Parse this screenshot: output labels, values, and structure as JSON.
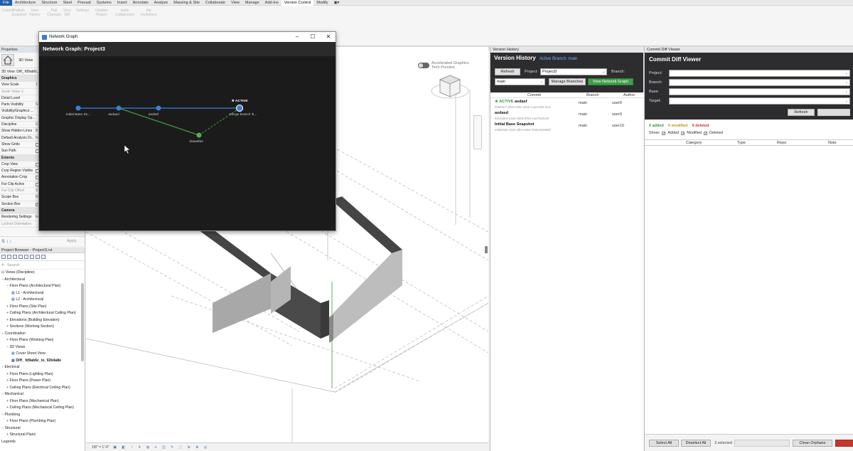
{
  "ribbon": {
    "tabs": [
      "File",
      "Architecture",
      "Structure",
      "Steel",
      "Precast",
      "Systems",
      "Insert",
      "Annotate",
      "Analyze",
      "Massing & Site",
      "Collaborate",
      "View",
      "Manage",
      "Add-Ins",
      "Version Control",
      "Modify"
    ],
    "active_tab": "Version Control",
    "buttons": [
      {
        "label": "Commit",
        "sub": ""
      },
      {
        "label": "Publish",
        "sub": "Snapshot"
      },
      {
        "label": "View",
        "sub": "History"
      },
      {
        "label": "Pull",
        "sub": "Changes"
      },
      {
        "label": "View",
        "sub": "Diff"
      },
      {
        "label": "Settings",
        "sub": ""
      },
      {
        "label": "Initialize",
        "sub": "Project"
      },
      {
        "label": "Invite",
        "sub": "Collaborator"
      },
      {
        "label": "My",
        "sub": "Invitations"
      }
    ]
  },
  "properties": {
    "title": "Properties",
    "type_label": "3D View",
    "view_selector": "3D View: Diff_ fd9ab6c_to",
    "rows": [
      {
        "label": "Graphics",
        "value": "",
        "kind": "section"
      },
      {
        "label": "View Scale",
        "value": "1",
        "kind": "text"
      },
      {
        "label": "Scale Value  1:",
        "value": "",
        "kind": "disabled"
      },
      {
        "label": "Detail Level",
        "value": "",
        "kind": "text"
      },
      {
        "label": "Parts Visibility",
        "value": "S",
        "kind": "text"
      },
      {
        "label": "Visibility/Graphics ...",
        "value": "",
        "kind": "text"
      },
      {
        "label": "Graphic Display Op...",
        "value": "",
        "kind": "text"
      },
      {
        "label": "Discipline",
        "value": "C",
        "kind": "text"
      },
      {
        "label": "Show Hidden Lines",
        "value": "B",
        "kind": "text"
      },
      {
        "label": "Default Analysis Di...",
        "value": "N",
        "kind": "text"
      },
      {
        "label": "Show Grids",
        "value": "",
        "kind": "check"
      },
      {
        "label": "Sun Path",
        "value": "",
        "kind": "check"
      },
      {
        "label": "Extents",
        "value": "",
        "kind": "section"
      },
      {
        "label": "Crop View",
        "value": "",
        "kind": "check"
      },
      {
        "label": "Crop Region Visible",
        "value": "",
        "kind": "check"
      },
      {
        "label": "Annotation Crop",
        "value": "",
        "kind": "check"
      },
      {
        "label": "Far Clip Active",
        "value": "",
        "kind": "check"
      },
      {
        "label": "Far Clip Offset",
        "value": "3",
        "kind": "disabled"
      },
      {
        "label": "Scope Box",
        "value": "N",
        "kind": "text"
      },
      {
        "label": "Section Box",
        "value": "",
        "kind": "checkon"
      },
      {
        "label": "Camera",
        "value": "",
        "kind": "section"
      },
      {
        "label": "Rendering Settings",
        "value": "Edit...",
        "kind": "text"
      },
      {
        "label": "Locked Orientation",
        "value": "",
        "kind": "disabled"
      }
    ],
    "apply_label": "Apply"
  },
  "project_browser": {
    "title": "Project Browser - Project3.rvt",
    "search_placeholder": "Search",
    "items": [
      {
        "label": "Views (Discipline)",
        "level": 0,
        "prefix": "⊟",
        "icon": false,
        "sel": false
      },
      {
        "label": "Architectural",
        "level": 0,
        "prefix": "−",
        "icon": false,
        "sel": false
      },
      {
        "label": "Floor Plans (Architectural Plan)",
        "level": 1,
        "prefix": "−",
        "icon": false,
        "sel": false
      },
      {
        "label": "L1 - Architectural",
        "level": 2,
        "prefix": "",
        "icon": true,
        "sel": false
      },
      {
        "label": "L2 - Architectural",
        "level": 2,
        "prefix": "",
        "icon": true,
        "sel": false
      },
      {
        "label": "Floor Plans (Site Plan)",
        "level": 1,
        "prefix": "+",
        "icon": false,
        "sel": false
      },
      {
        "label": "Ceiling Plans (Architectural Ceiling Plan)",
        "level": 1,
        "prefix": "+",
        "icon": false,
        "sel": false
      },
      {
        "label": "Elevations (Building Elevation)",
        "level": 1,
        "prefix": "+",
        "icon": false,
        "sel": false
      },
      {
        "label": "Sections (Working Section)",
        "level": 1,
        "prefix": "+",
        "icon": false,
        "sel": false
      },
      {
        "label": "Coordination",
        "level": 0,
        "prefix": "−",
        "icon": false,
        "sel": false
      },
      {
        "label": "Floor Plans (Working Plan)",
        "level": 1,
        "prefix": "+",
        "icon": false,
        "sel": false
      },
      {
        "label": "3D Views",
        "level": 1,
        "prefix": "−",
        "icon": false,
        "sel": false
      },
      {
        "label": "Cover Sheet View",
        "level": 2,
        "prefix": "",
        "icon": true,
        "sel": false
      },
      {
        "label": "Diff_ fd9ab6c_to_92b4a8e",
        "level": 2,
        "prefix": "",
        "icon": true,
        "sel": true
      },
      {
        "label": "Electrical",
        "level": 0,
        "prefix": "−",
        "icon": false,
        "sel": false
      },
      {
        "label": "Floor Plans (Lighting Plan)",
        "level": 1,
        "prefix": "+",
        "icon": false,
        "sel": false
      },
      {
        "label": "Floor Plans (Power Plan)",
        "level": 1,
        "prefix": "+",
        "icon": false,
        "sel": false
      },
      {
        "label": "Ceiling Plans (Electrical Ceiling Plan)",
        "level": 1,
        "prefix": "+",
        "icon": false,
        "sel": false
      },
      {
        "label": "Mechanical",
        "level": 0,
        "prefix": "−",
        "icon": false,
        "sel": false
      },
      {
        "label": "Floor Plans (Mechanical Plan)",
        "level": 1,
        "prefix": "+",
        "icon": false,
        "sel": false
      },
      {
        "label": "Ceiling Plans (Mechanical Ceiling Plan)",
        "level": 1,
        "prefix": "+",
        "icon": false,
        "sel": false
      },
      {
        "label": "Plumbing",
        "level": 0,
        "prefix": "−",
        "icon": false,
        "sel": false
      },
      {
        "label": "Floor Plans (Plumbing Plan)",
        "level": 1,
        "prefix": "+",
        "icon": false,
        "sel": false
      },
      {
        "label": "Structural",
        "level": 0,
        "prefix": "−",
        "icon": false,
        "sel": false
      },
      {
        "label": "Structural Plans",
        "level": 1,
        "prefix": "+",
        "icon": false,
        "sel": false
      },
      {
        "label": "Legends",
        "level": 0,
        "prefix": "",
        "icon": false,
        "sel": false
      }
    ]
  },
  "viewport": {
    "accel_line1": "Accelerated Graphics",
    "accel_line2": "Tech Preview",
    "scale": "1/8\" = 1'-0\""
  },
  "network_graph": {
    "window_title": "Network Graph",
    "header": "Network Graph: Project3",
    "active_badge": "★ ACTIVE",
    "nodes": [
      {
        "label": "Initial Base Sn..."
      },
      {
        "label": "asdasd"
      },
      {
        "label": "asdasf"
      },
      {
        "label": "Merge branch 'b..."
      },
      {
        "label": "dsaasfas"
      }
    ],
    "colors": {
      "main": "#3b7fd4",
      "branch": "#3e9a3e",
      "bg": "#1b1b1b"
    }
  },
  "version_history": {
    "pane_title": "Version History",
    "title": "Version History",
    "active_branch": "Active Branch: main",
    "refresh": "Refresh",
    "project_label": "Project:",
    "project_value": "Project3",
    "branch_label": "Branch:",
    "branch_value": "main",
    "manage_branches": "Manage Branches",
    "view_network_graph": "View Network Graph",
    "columns": [
      "Commit",
      "Branch",
      "Author"
    ],
    "commits": [
      {
        "active": "★ ACTIVE",
        "message": "asdasf",
        "hash": "fd9ab6c7-0b44-409c-a932-1ca21369 18ce",
        "branch": "main",
        "author": "user9"
      },
      {
        "active": "",
        "message": "asdasd",
        "hash": "92b4a8e4-e2a0-43b8-87b9-14a7f2cba29",
        "branch": "main",
        "author": "user9"
      },
      {
        "active": "",
        "message": "Initial Base Snapshot",
        "hash": "e0b8d4de-cbd4-4db4-9de0-7b8e2548906f",
        "branch": "main",
        "author": "user10"
      }
    ]
  },
  "commit_diff": {
    "pane_title": "Commit Diff Viewer",
    "title": "Commit Diff Viewer",
    "fields": [
      "Project:",
      "Branch:",
      "Base:",
      "Target:"
    ],
    "refresh": "Refresh",
    "added": "0 added",
    "modified": "0 modified",
    "deleted": "0 deleted",
    "show_label": "Show:",
    "show_added": "Added",
    "show_modified": "Modified",
    "show_deleted": "Deleted",
    "columns": [
      "Category",
      "Type",
      "Repo",
      "Note"
    ],
    "select_all": "Select All",
    "deselect_all": "Deselect All",
    "selected": "3 selected",
    "clean_orphans": "Clean Orphans",
    "colors": {
      "added": "#2e9a3c",
      "modified": "#c8901a",
      "deleted": "#c0392b"
    }
  }
}
